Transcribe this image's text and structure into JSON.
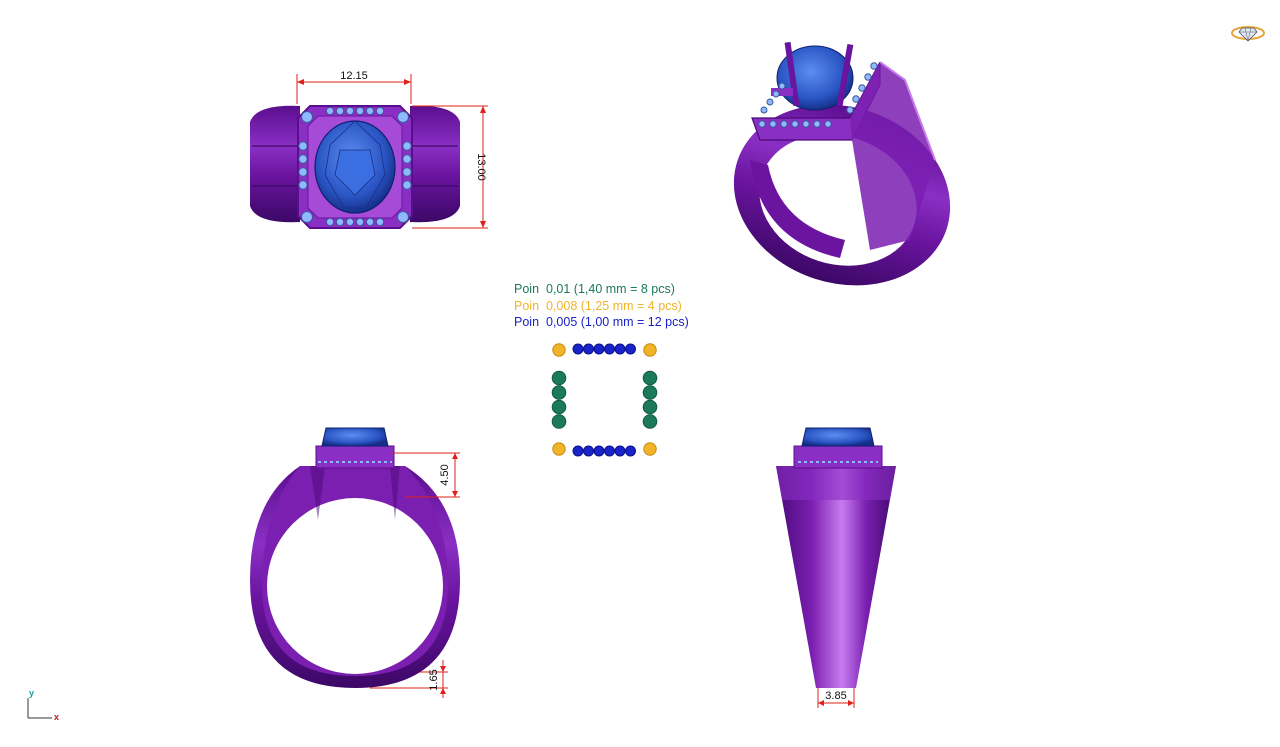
{
  "legend": [
    {
      "label": "Poin",
      "value": "0,01 (1,40 mm = 8 pcs)",
      "color": "#1b7a5a"
    },
    {
      "label": "Poin",
      "value": "0,008 (1,25 mm = 4 pcs)",
      "color": "#f0b429"
    },
    {
      "label": "Poin",
      "value": "0,005 (1,00 mm = 12 pcs)",
      "color": "#1a22c9"
    }
  ],
  "dimensions": {
    "top_width": "12.15",
    "top_height": "13.00",
    "front_setting_height": "4.50",
    "front_shank_thickness": "1.65",
    "side_shank_width": "3.85"
  },
  "axes": {
    "y": "y",
    "x": "x"
  },
  "colors": {
    "metal": "#7a1fb0",
    "metal_dark": "#4b0a78",
    "metal_light": "#b85fe6",
    "stone": "#2f5fd0",
    "accent_stone": "#8fb8ff",
    "dimension": "#e0201b"
  }
}
